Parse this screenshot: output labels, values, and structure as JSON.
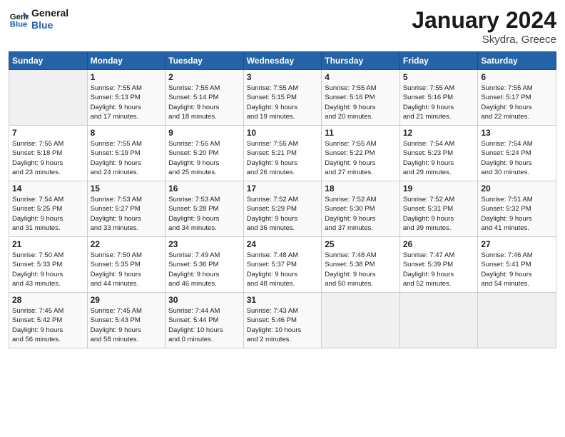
{
  "header": {
    "logo_line1": "General",
    "logo_line2": "Blue",
    "title": "January 2024",
    "subtitle": "Skydra, Greece"
  },
  "days_of_week": [
    "Sunday",
    "Monday",
    "Tuesday",
    "Wednesday",
    "Thursday",
    "Friday",
    "Saturday"
  ],
  "weeks": [
    [
      {
        "day": "",
        "sunrise": "",
        "sunset": "",
        "daylight": "",
        "empty": true
      },
      {
        "day": "1",
        "sunrise": "Sunrise: 7:55 AM",
        "sunset": "Sunset: 5:13 PM",
        "daylight": "Daylight: 9 hours",
        "daylight2": "and 17 minutes."
      },
      {
        "day": "2",
        "sunrise": "Sunrise: 7:55 AM",
        "sunset": "Sunset: 5:14 PM",
        "daylight": "Daylight: 9 hours",
        "daylight2": "and 18 minutes."
      },
      {
        "day": "3",
        "sunrise": "Sunrise: 7:55 AM",
        "sunset": "Sunset: 5:15 PM",
        "daylight": "Daylight: 9 hours",
        "daylight2": "and 19 minutes."
      },
      {
        "day": "4",
        "sunrise": "Sunrise: 7:55 AM",
        "sunset": "Sunset: 5:16 PM",
        "daylight": "Daylight: 9 hours",
        "daylight2": "and 20 minutes."
      },
      {
        "day": "5",
        "sunrise": "Sunrise: 7:55 AM",
        "sunset": "Sunset: 5:16 PM",
        "daylight": "Daylight: 9 hours",
        "daylight2": "and 21 minutes."
      },
      {
        "day": "6",
        "sunrise": "Sunrise: 7:55 AM",
        "sunset": "Sunset: 5:17 PM",
        "daylight": "Daylight: 9 hours",
        "daylight2": "and 22 minutes."
      }
    ],
    [
      {
        "day": "7",
        "sunrise": "Sunrise: 7:55 AM",
        "sunset": "Sunset: 5:18 PM",
        "daylight": "Daylight: 9 hours",
        "daylight2": "and 23 minutes."
      },
      {
        "day": "8",
        "sunrise": "Sunrise: 7:55 AM",
        "sunset": "Sunset: 5:19 PM",
        "daylight": "Daylight: 9 hours",
        "daylight2": "and 24 minutes."
      },
      {
        "day": "9",
        "sunrise": "Sunrise: 7:55 AM",
        "sunset": "Sunset: 5:20 PM",
        "daylight": "Daylight: 9 hours",
        "daylight2": "and 25 minutes."
      },
      {
        "day": "10",
        "sunrise": "Sunrise: 7:55 AM",
        "sunset": "Sunset: 5:21 PM",
        "daylight": "Daylight: 9 hours",
        "daylight2": "and 26 minutes."
      },
      {
        "day": "11",
        "sunrise": "Sunrise: 7:55 AM",
        "sunset": "Sunset: 5:22 PM",
        "daylight": "Daylight: 9 hours",
        "daylight2": "and 27 minutes."
      },
      {
        "day": "12",
        "sunrise": "Sunrise: 7:54 AM",
        "sunset": "Sunset: 5:23 PM",
        "daylight": "Daylight: 9 hours",
        "daylight2": "and 29 minutes."
      },
      {
        "day": "13",
        "sunrise": "Sunrise: 7:54 AM",
        "sunset": "Sunset: 5:24 PM",
        "daylight": "Daylight: 9 hours",
        "daylight2": "and 30 minutes."
      }
    ],
    [
      {
        "day": "14",
        "sunrise": "Sunrise: 7:54 AM",
        "sunset": "Sunset: 5:25 PM",
        "daylight": "Daylight: 9 hours",
        "daylight2": "and 31 minutes."
      },
      {
        "day": "15",
        "sunrise": "Sunrise: 7:53 AM",
        "sunset": "Sunset: 5:27 PM",
        "daylight": "Daylight: 9 hours",
        "daylight2": "and 33 minutes."
      },
      {
        "day": "16",
        "sunrise": "Sunrise: 7:53 AM",
        "sunset": "Sunset: 5:28 PM",
        "daylight": "Daylight: 9 hours",
        "daylight2": "and 34 minutes."
      },
      {
        "day": "17",
        "sunrise": "Sunrise: 7:52 AM",
        "sunset": "Sunset: 5:29 PM",
        "daylight": "Daylight: 9 hours",
        "daylight2": "and 36 minutes."
      },
      {
        "day": "18",
        "sunrise": "Sunrise: 7:52 AM",
        "sunset": "Sunset: 5:30 PM",
        "daylight": "Daylight: 9 hours",
        "daylight2": "and 37 minutes."
      },
      {
        "day": "19",
        "sunrise": "Sunrise: 7:52 AM",
        "sunset": "Sunset: 5:31 PM",
        "daylight": "Daylight: 9 hours",
        "daylight2": "and 39 minutes."
      },
      {
        "day": "20",
        "sunrise": "Sunrise: 7:51 AM",
        "sunset": "Sunset: 5:32 PM",
        "daylight": "Daylight: 9 hours",
        "daylight2": "and 41 minutes."
      }
    ],
    [
      {
        "day": "21",
        "sunrise": "Sunrise: 7:50 AM",
        "sunset": "Sunset: 5:33 PM",
        "daylight": "Daylight: 9 hours",
        "daylight2": "and 43 minutes."
      },
      {
        "day": "22",
        "sunrise": "Sunrise: 7:50 AM",
        "sunset": "Sunset: 5:35 PM",
        "daylight": "Daylight: 9 hours",
        "daylight2": "and 44 minutes."
      },
      {
        "day": "23",
        "sunrise": "Sunrise: 7:49 AM",
        "sunset": "Sunset: 5:36 PM",
        "daylight": "Daylight: 9 hours",
        "daylight2": "and 46 minutes."
      },
      {
        "day": "24",
        "sunrise": "Sunrise: 7:48 AM",
        "sunset": "Sunset: 5:37 PM",
        "daylight": "Daylight: 9 hours",
        "daylight2": "and 48 minutes."
      },
      {
        "day": "25",
        "sunrise": "Sunrise: 7:48 AM",
        "sunset": "Sunset: 5:38 PM",
        "daylight": "Daylight: 9 hours",
        "daylight2": "and 50 minutes."
      },
      {
        "day": "26",
        "sunrise": "Sunrise: 7:47 AM",
        "sunset": "Sunset: 5:39 PM",
        "daylight": "Daylight: 9 hours",
        "daylight2": "and 52 minutes."
      },
      {
        "day": "27",
        "sunrise": "Sunrise: 7:46 AM",
        "sunset": "Sunset: 5:41 PM",
        "daylight": "Daylight: 9 hours",
        "daylight2": "and 54 minutes."
      }
    ],
    [
      {
        "day": "28",
        "sunrise": "Sunrise: 7:45 AM",
        "sunset": "Sunset: 5:42 PM",
        "daylight": "Daylight: 9 hours",
        "daylight2": "and 56 minutes."
      },
      {
        "day": "29",
        "sunrise": "Sunrise: 7:45 AM",
        "sunset": "Sunset: 5:43 PM",
        "daylight": "Daylight: 9 hours",
        "daylight2": "and 58 minutes."
      },
      {
        "day": "30",
        "sunrise": "Sunrise: 7:44 AM",
        "sunset": "Sunset: 5:44 PM",
        "daylight": "Daylight: 10 hours",
        "daylight2": "and 0 minutes."
      },
      {
        "day": "31",
        "sunrise": "Sunrise: 7:43 AM",
        "sunset": "Sunset: 5:46 PM",
        "daylight": "Daylight: 10 hours",
        "daylight2": "and 2 minutes."
      },
      {
        "day": "",
        "sunrise": "",
        "sunset": "",
        "daylight": "",
        "daylight2": "",
        "empty": true
      },
      {
        "day": "",
        "sunrise": "",
        "sunset": "",
        "daylight": "",
        "daylight2": "",
        "empty": true
      },
      {
        "day": "",
        "sunrise": "",
        "sunset": "",
        "daylight": "",
        "daylight2": "",
        "empty": true
      }
    ]
  ]
}
